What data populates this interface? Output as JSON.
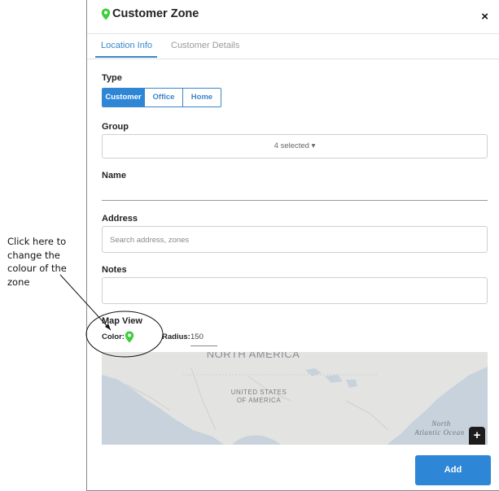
{
  "annotation": {
    "lines": [
      "Click here to",
      "change the",
      "colour of the",
      "zone"
    ]
  },
  "modal": {
    "title": "Customer Zone",
    "close_label": "×",
    "tabs": [
      {
        "label": "Location Info",
        "active": true
      },
      {
        "label": "Customer Details",
        "active": false
      }
    ]
  },
  "form": {
    "type_label": "Type",
    "type_options": [
      {
        "label": "Customer",
        "selected": true
      },
      {
        "label": "Office",
        "selected": false
      },
      {
        "label": "Home",
        "selected": false
      }
    ],
    "group_label": "Group",
    "group_value": "4 selected ▾",
    "name_label": "Name",
    "name_value": "",
    "address_label": "Address",
    "address_placeholder": "Search address, zones",
    "notes_label": "Notes",
    "notes_value": ""
  },
  "map_view": {
    "label": "Map View",
    "color_label": "Color:",
    "zone_color": "#3ccf3c",
    "radius_label": "Radius:",
    "radius_value": "150",
    "map_labels": {
      "continent": "NORTH AMERICA",
      "country": [
        "UNITED STATES",
        "OF AMERICA"
      ],
      "ocean": [
        "North",
        "Atlantic Ocean"
      ]
    },
    "zoom_in_label": "+"
  },
  "footer": {
    "add_label": "Add"
  },
  "colors": {
    "accent": "#2d86d6",
    "pin": "#3ccf3c"
  }
}
